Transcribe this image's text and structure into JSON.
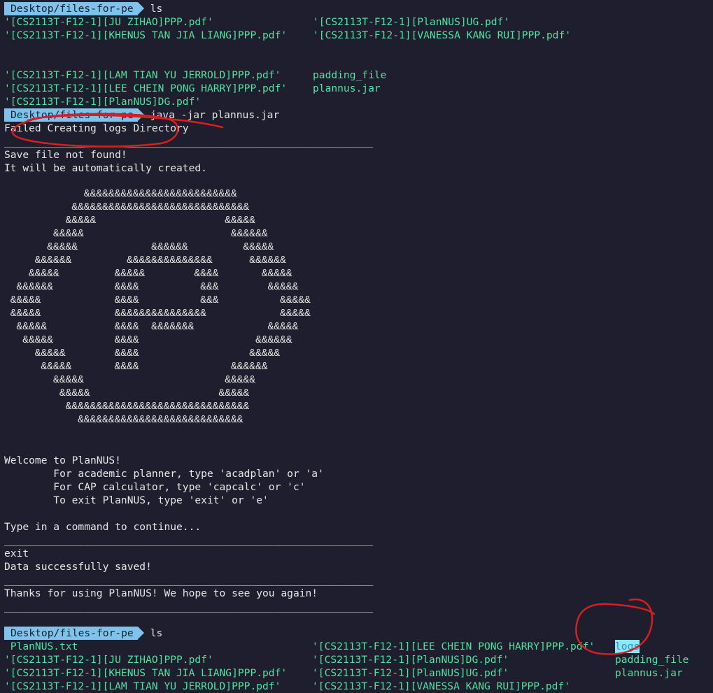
{
  "prompt": "Desktop/files-for-pe",
  "session1": {
    "command": "ls",
    "rows": [
      [
        "'[CS2113T-F12-1][JU ZIHAO]PPP.pdf'",
        "'[CS2113T-F12-1][PlanNUS]UG.pdf'"
      ],
      [
        "'[CS2113T-F12-1][KHENUS TAN JIA LIANG]PPP.pdf'",
        "'[CS2113T-F12-1][VANESSA KANG RUI]PPP.pdf'"
      ]
    ],
    "rows2": [
      [
        "'[CS2113T-F12-1][LAM TIAN YU JERROLD]PPP.pdf'",
        "padding_file"
      ],
      [
        "'[CS2113T-F12-1][LEE CHEIN PONG HARRY]PPP.pdf'",
        "plannus.jar"
      ],
      [
        "'[CS2113T-F12-1][PlanNUS]DG.pdf'",
        ""
      ]
    ]
  },
  "session2": {
    "command": "java -jar plannus.jar",
    "output": {
      "failed": "Failed Creating logs Directory",
      "divider": "____________________________________________________________",
      "save_not_found": "Save file not found!",
      "auto_created": "It will be automatically created.",
      "ascii_art": "             &&&&&&&&&&&&&&&&&&&&&&&&&\n           &&&&&&&&&&&&&&&&&&&&&&&&&&&&&\n          &&&&&                     &&&&&\n        &&&&&                        &&&&&&\n       &&&&&            &&&&&&         &&&&&\n     &&&&&&         &&&&&&&&&&&&&&      &&&&&&\n    &&&&&         &&&&&        &&&&       &&&&&\n  &&&&&&          &&&&          &&&        &&&&&\n &&&&&            &&&&          &&&          &&&&&\n &&&&&            &&&&&&&&&&&&&&&            &&&&&\n  &&&&&           &&&&  &&&&&&&            &&&&&\n   &&&&&          &&&&                   &&&&&&\n     &&&&&        &&&&                  &&&&&\n      &&&&&       &&&&               &&&&&&\n        &&&&&                       &&&&&\n         &&&&&                     &&&&&\n          &&&&&&&&&&&&&&&&&&&&&&&&&&&&&&\n            &&&&&&&&&&&&&&&&&&&&&&&&&&&",
      "welcome": "Welcome to PlanNUS!",
      "opt1": "        For academic planner, type 'acadplan' or 'a'",
      "opt2": "        For CAP calculator, type 'capcalc' or 'c'",
      "opt3": "        To exit PlanNUS, type 'exit' or 'e'",
      "type_in": "Type in a command to continue...",
      "user_input": "exit",
      "saved": "Data successfully saved!",
      "thanks": "Thanks for using PlanNUS! We hope to see you again!"
    }
  },
  "session3": {
    "command": "ls",
    "rows": [
      [
        " PlanNUS.txt",
        "'[CS2113T-F12-1][LEE CHEIN PONG HARRY]PPP.pdf'",
        "logs"
      ],
      [
        "'[CS2113T-F12-1][JU ZIHAO]PPP.pdf'",
        "'[CS2113T-F12-1][PlanNUS]DG.pdf'",
        "padding_file"
      ],
      [
        "'[CS2113T-F12-1][KHENUS TAN JIA LIANG]PPP.pdf'",
        "'[CS2113T-F12-1][PlanNUS]UG.pdf'",
        "plannus.jar"
      ],
      [
        "'[CS2113T-F12-1][LAM TIAN YU JERROLD]PPP.pdf'",
        "'[CS2113T-F12-1][VANESSA KANG RUI]PPP.pdf'",
        ""
      ]
    ]
  },
  "colors": {
    "background": "#1e1e2e",
    "prompt_bg": "#7ec3ec",
    "file_green": "#4fe3a0",
    "annotation_red": "#d81e1e"
  }
}
